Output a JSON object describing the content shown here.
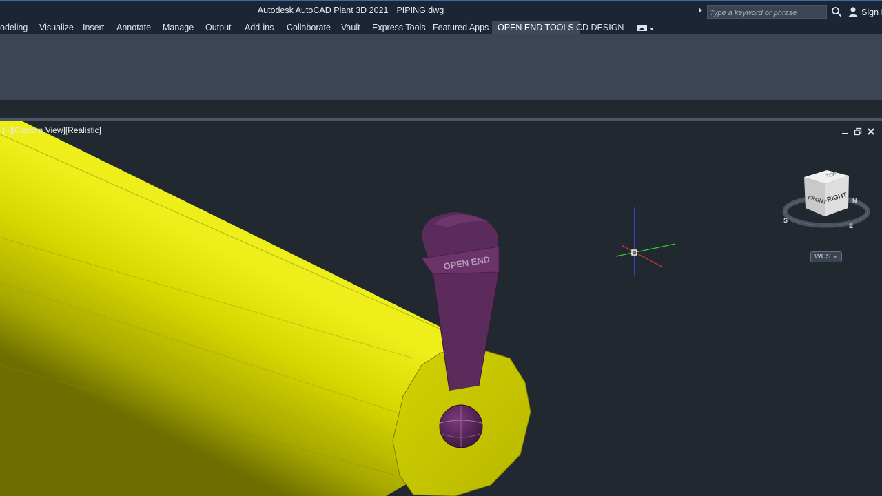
{
  "window": {
    "app_name": "Autodesk AutoCAD Plant 3D 2021",
    "file_name": "PIPING.dwg",
    "search_placeholder": "Type a keyword or phrase",
    "sign_in": "Sign In"
  },
  "ribbon": {
    "tabs": [
      {
        "label": "odeling"
      },
      {
        "label": "Visualize"
      },
      {
        "label": "Insert"
      },
      {
        "label": "Annotate"
      },
      {
        "label": "Manage"
      },
      {
        "label": "Output"
      },
      {
        "label": "Add-ins"
      },
      {
        "label": "Collaborate"
      },
      {
        "label": "Vault"
      },
      {
        "label": "Express Tools"
      },
      {
        "label": "Featured Apps"
      },
      {
        "label": "OPEN END TOOLS",
        "active": true
      },
      {
        "label": "CD DESIGN"
      }
    ]
  },
  "viewport": {
    "label": "[−][Custom View][Realistic]",
    "controls": [
      "minimize-icon",
      "restore-icon",
      "close-icon"
    ]
  },
  "scene": {
    "pipe_color": "#c8c800",
    "marker_color": "#5c2a5c",
    "marker_text": "OPEN END"
  },
  "viewcube": {
    "faces": {
      "front": "FRONT",
      "right": "RIGHT",
      "top": "TOP"
    },
    "compass": {
      "n": "N",
      "s": "S",
      "e": "E"
    },
    "wcs_label": "WCS"
  }
}
